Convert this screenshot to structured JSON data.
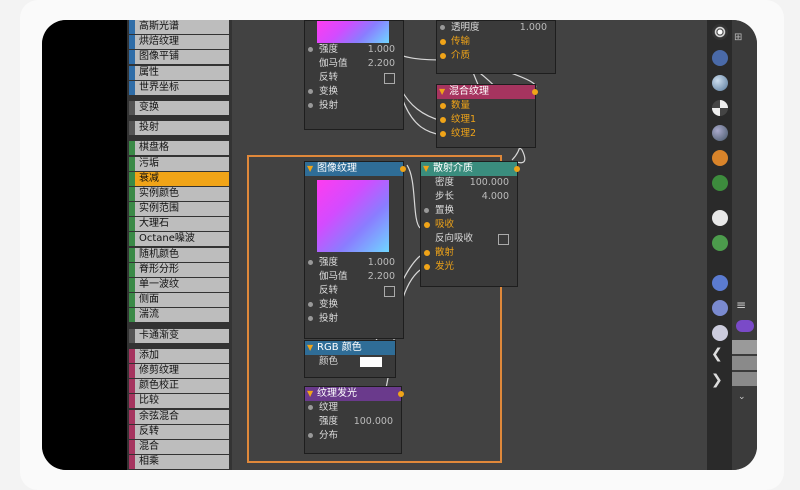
{
  "sidebar_list": {
    "items": [
      {
        "label": "高斯光谱",
        "color": "#2f6da8"
      },
      {
        "label": "烘焙纹理",
        "color": "#2f6da8"
      },
      {
        "label": "图像平铺",
        "color": "#2f6da8"
      },
      {
        "label": "属性",
        "color": "#2f6da8"
      },
      {
        "label": "世界坐标",
        "color": "#2f6da8"
      },
      {
        "label": "变换",
        "color": "#555555"
      },
      {
        "label": "投射",
        "color": "#555555"
      },
      {
        "label": "棋盘格",
        "color": "#3a8a47"
      },
      {
        "label": "污垢",
        "color": "#3a8a47"
      },
      {
        "label": "衰减",
        "color": "#3a8a47"
      },
      {
        "label": "实例颜色",
        "color": "#3a8a47"
      },
      {
        "label": "实例范围",
        "color": "#3a8a47"
      },
      {
        "label": "大理石",
        "color": "#3a8a47"
      },
      {
        "label": "Octane噪波",
        "color": "#3a8a47"
      },
      {
        "label": "随机颜色",
        "color": "#3a8a47"
      },
      {
        "label": "脊形分形",
        "color": "#3a8a47"
      },
      {
        "label": "单一波纹",
        "color": "#3a8a47"
      },
      {
        "label": "侧面",
        "color": "#3a8a47"
      },
      {
        "label": "湍流",
        "color": "#3a8a47"
      },
      {
        "label": "卡通渐变",
        "color": "#555555"
      },
      {
        "label": "添加",
        "color": "#a6345f"
      },
      {
        "label": "修剪纹理",
        "color": "#a6345f"
      },
      {
        "label": "颜色校正",
        "color": "#a6345f"
      },
      {
        "label": "比较",
        "color": "#a6345f"
      },
      {
        "label": "余弦混合",
        "color": "#a6345f"
      },
      {
        "label": "反转",
        "color": "#a6345f"
      },
      {
        "label": "混合",
        "color": "#a6345f"
      },
      {
        "label": "相乘",
        "color": "#a6345f"
      }
    ],
    "active_label": "衰减"
  },
  "node_top_image": {
    "rows": {
      "strength": "强度",
      "strength_val": "1.000",
      "gamma": "伽马值",
      "gamma_val": "2.200",
      "invert": "反转",
      "transform": "变换",
      "projection": "投射"
    }
  },
  "node_top_material": {
    "rows": {
      "opacity": "透明度",
      "opacity_val": "1.000",
      "transmission": "传输",
      "medium": "介质"
    }
  },
  "node_mix": {
    "title": "混合纹理",
    "rows": {
      "amount": "数量",
      "tex1": "纹理1",
      "tex2": "纹理2"
    }
  },
  "node_image": {
    "title": "图像纹理",
    "rows": {
      "strength": "强度",
      "strength_val": "1.000",
      "gamma": "伽马值",
      "gamma_val": "2.200",
      "invert": "反转",
      "transform": "变换",
      "projection": "投射"
    }
  },
  "node_scatter": {
    "title": "散射介质",
    "rows": {
      "density": "密度",
      "density_val": "100.000",
      "step": "步长",
      "step_val": "4.000",
      "displace": "置换",
      "absorb": "吸收",
      "invert_absorb": "反向吸收",
      "scatter": "散射",
      "emission": "发光"
    }
  },
  "node_rgb": {
    "title": "RGB 颜色",
    "color_label": "颜色"
  },
  "node_emission": {
    "title": "纹理发光",
    "rows": {
      "texture": "纹理",
      "strength": "强度",
      "strength_val": "100.000",
      "distribution": "分布"
    }
  },
  "colors": {
    "accent": "#f0a418",
    "frame": "#e0883a",
    "header_teal": "#3a8d7e",
    "header_blue": "#2f6d97",
    "header_purple": "#6a3a8c",
    "header_red": "#a6345f"
  }
}
